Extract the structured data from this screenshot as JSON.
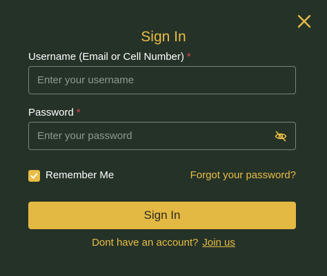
{
  "modal": {
    "title": "Sign In",
    "close_icon": "close-icon"
  },
  "username": {
    "label": "Username (Email or Cell Number)",
    "required_mark": "*",
    "placeholder": "Enter your username",
    "value": ""
  },
  "password": {
    "label": "Password",
    "required_mark": "*",
    "placeholder": "Enter your password",
    "value": "",
    "toggle_icon": "eye-slash-icon"
  },
  "remember": {
    "label": "Remember Me",
    "checked": true
  },
  "forgot_link": "Forgot your password?",
  "submit_label": "Sign In",
  "footer": {
    "text": "Dont have an account?",
    "link": "Join us"
  },
  "colors": {
    "background": "#253228",
    "accent": "#e8bd45",
    "button": "#e3b944",
    "required": "#e0444b"
  }
}
